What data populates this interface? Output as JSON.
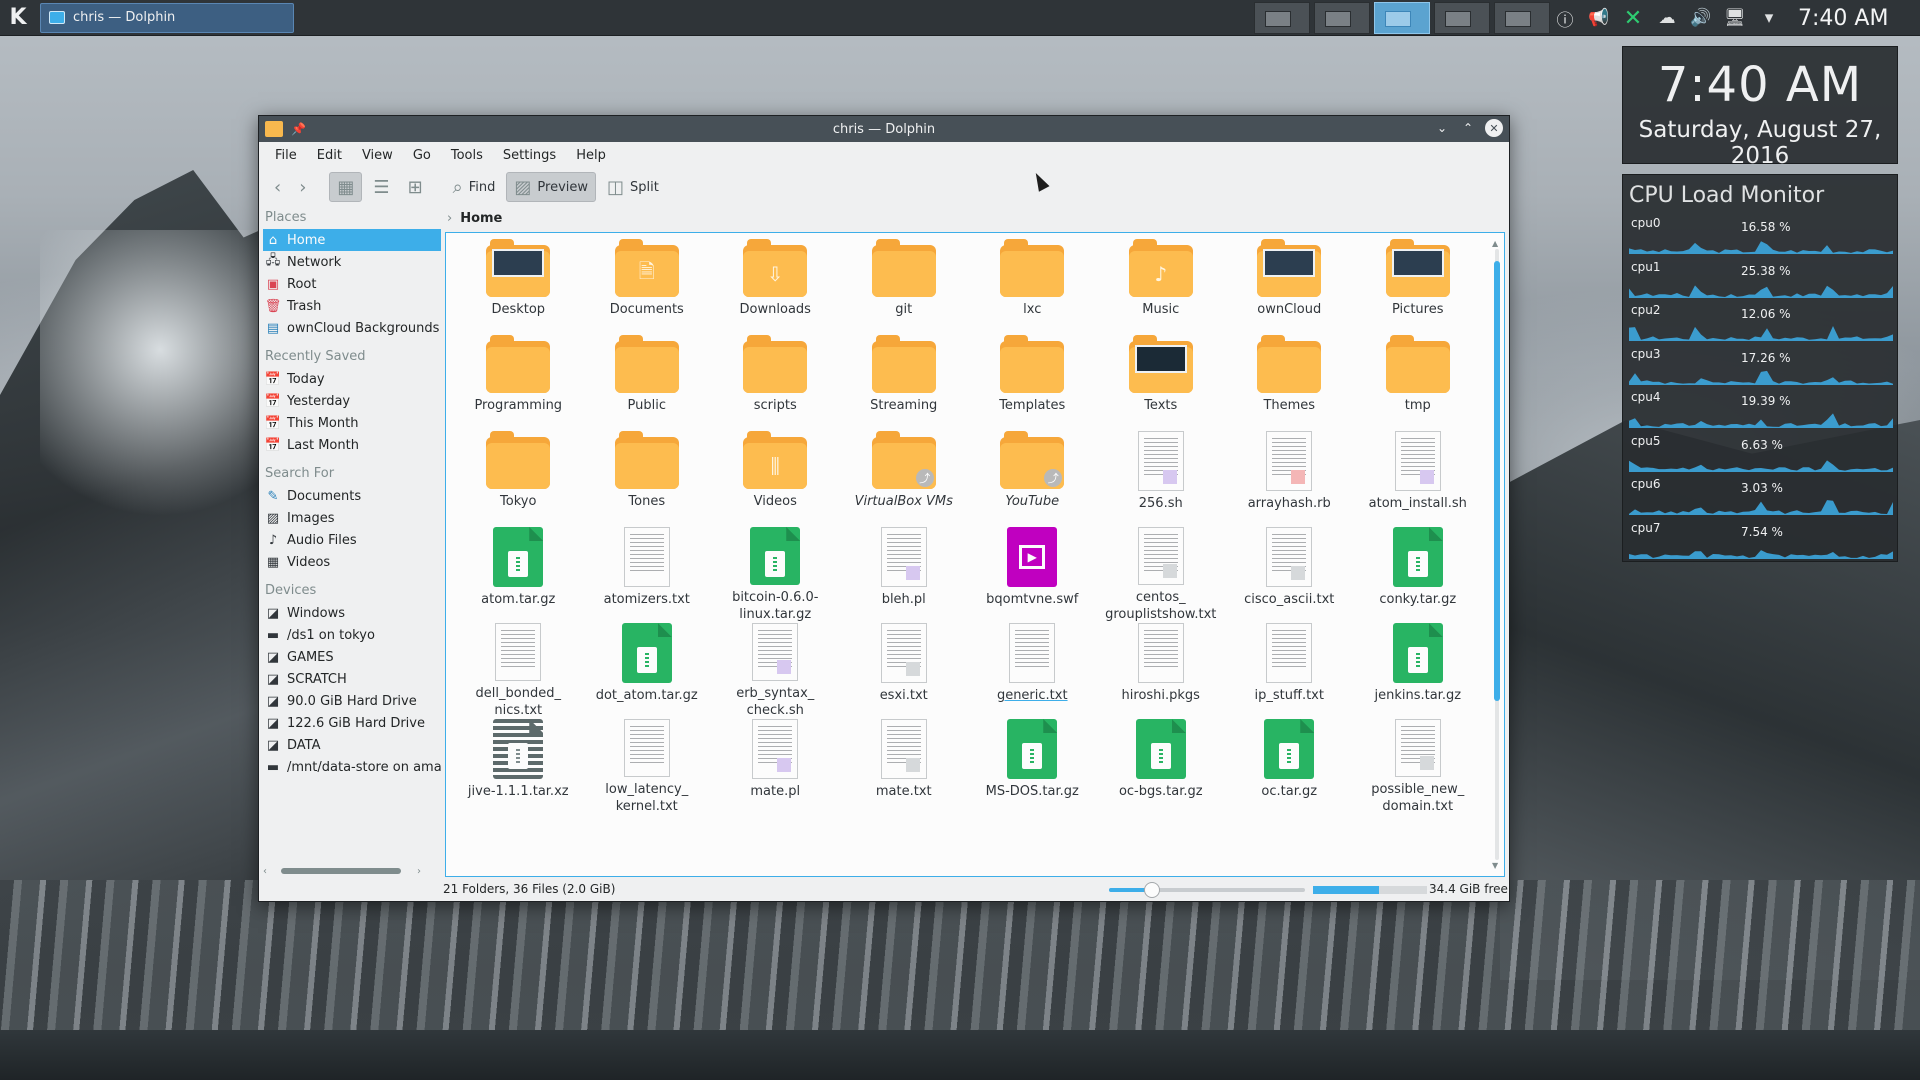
{
  "taskbar": {
    "task_label": "chris — Dolphin",
    "clock": "7:40 AM"
  },
  "clock_widget": {
    "time": "7:40 AM",
    "date": "Saturday, August 27, 2016"
  },
  "cpu_widget": {
    "title": "CPU Load Monitor",
    "cores": [
      {
        "name": "cpu0",
        "value": "16.58 %"
      },
      {
        "name": "cpu1",
        "value": "25.38 %"
      },
      {
        "name": "cpu2",
        "value": "12.06 %"
      },
      {
        "name": "cpu3",
        "value": "17.26 %"
      },
      {
        "name": "cpu4",
        "value": "19.39 %"
      },
      {
        "name": "cpu5",
        "value": "6.63 %"
      },
      {
        "name": "cpu6",
        "value": "3.03 %"
      },
      {
        "name": "cpu7",
        "value": "7.54 %"
      }
    ],
    "graph_color": "#3daee9"
  },
  "window": {
    "title": "chris — Dolphin",
    "menu": [
      "File",
      "Edit",
      "View",
      "Go",
      "Tools",
      "Settings",
      "Help"
    ],
    "toolbar": {
      "find": "Find",
      "preview": "Preview",
      "split": "Split"
    },
    "breadcrumb": "Home",
    "status": "21 Folders, 36 Files (2.0 GiB)",
    "zoom_level": 0.22,
    "disk_used_fraction": 0.58,
    "free_space": "34.4 GiB free"
  },
  "sidebar": {
    "places_header": "Places",
    "places": [
      "Home",
      "Network",
      "Root",
      "Trash",
      "ownCloud Backgrounds"
    ],
    "recent_header": "Recently Saved",
    "recent": [
      "Today",
      "Yesterday",
      "This Month",
      "Last Month"
    ],
    "search_header": "Search For",
    "search": [
      "Documents",
      "Images",
      "Audio Files",
      "Videos"
    ],
    "devices_header": "Devices",
    "devices": [
      "Windows",
      "/ds1 on tokyo",
      "GAMES",
      "SCRATCH",
      "90.0 GiB Hard Drive",
      "122.6 GiB Hard Drive",
      "DATA",
      "/mnt/data-store on amate"
    ]
  },
  "files": [
    {
      "name": "Desktop",
      "type": "folder",
      "icon": "screenshot"
    },
    {
      "name": "Documents",
      "type": "folder",
      "icon": "doc"
    },
    {
      "name": "Downloads",
      "type": "folder",
      "icon": "download"
    },
    {
      "name": "git",
      "type": "folder"
    },
    {
      "name": "lxc",
      "type": "folder"
    },
    {
      "name": "Music",
      "type": "folder",
      "icon": "music"
    },
    {
      "name": "ownCloud",
      "type": "folder",
      "icon": "screenshot"
    },
    {
      "name": "Pictures",
      "type": "folder",
      "icon": "screenshot"
    },
    {
      "name": "Programming",
      "type": "folder"
    },
    {
      "name": "Public",
      "type": "folder"
    },
    {
      "name": "scripts",
      "type": "folder"
    },
    {
      "name": "Streaming",
      "type": "folder"
    },
    {
      "name": "Templates",
      "type": "folder"
    },
    {
      "name": "Texts",
      "type": "folder",
      "icon": "dark"
    },
    {
      "name": "Themes",
      "type": "folder"
    },
    {
      "name": "tmp",
      "type": "folder"
    },
    {
      "name": "Tokyo",
      "type": "folder"
    },
    {
      "name": "Tones",
      "type": "folder"
    },
    {
      "name": "Videos",
      "type": "folder",
      "icon": "film"
    },
    {
      "name": "VirtualBox VMs",
      "type": "folder-link"
    },
    {
      "name": "YouTube",
      "type": "folder-link"
    },
    {
      "name": "256.sh",
      "type": "doc",
      "tag": "purple"
    },
    {
      "name": "arrayhash.rb",
      "type": "doc",
      "tag": "red"
    },
    {
      "name": "atom_install.sh",
      "type": "doc",
      "tag": "purple"
    },
    {
      "name": "atom.tar.gz",
      "type": "archive"
    },
    {
      "name": "atomizers.txt",
      "type": "doc"
    },
    {
      "name": "bitcoin-0.6.0-linux.tar.gz",
      "type": "archive"
    },
    {
      "name": "bleh.pl",
      "type": "doc",
      "tag": "purple"
    },
    {
      "name": "bqomtvne.swf",
      "type": "flash"
    },
    {
      "name": "centos_ grouplistshow.txt",
      "type": "doc",
      "tag": "gray"
    },
    {
      "name": "cisco_ascii.txt",
      "type": "doc",
      "tag": "gray"
    },
    {
      "name": "conky.tar.gz",
      "type": "archive"
    },
    {
      "name": "dell_bonded_ nics.txt",
      "type": "doc"
    },
    {
      "name": "dot_atom.tar.gz",
      "type": "archive"
    },
    {
      "name": "erb_syntax_ check.sh",
      "type": "doc",
      "tag": "purple"
    },
    {
      "name": "esxi.txt",
      "type": "doc",
      "tag": "gray"
    },
    {
      "name": "generic.txt",
      "type": "doc",
      "underlined": true
    },
    {
      "name": "hiroshi.pkgs",
      "type": "doc"
    },
    {
      "name": "ip_stuff.txt",
      "type": "doc"
    },
    {
      "name": "jenkins.tar.gz",
      "type": "archive"
    },
    {
      "name": "jive-1.1.1.tar.xz",
      "type": "archive-gray"
    },
    {
      "name": "low_latency_ kernel.txt",
      "type": "doc"
    },
    {
      "name": "mate.pl",
      "type": "doc",
      "tag": "purple"
    },
    {
      "name": "mate.txt",
      "type": "doc",
      "tag": "gray"
    },
    {
      "name": "MS-DOS.tar.gz",
      "type": "archive"
    },
    {
      "name": "oc-bgs.tar.gz",
      "type": "archive"
    },
    {
      "name": "oc.tar.gz",
      "type": "archive"
    },
    {
      "name": "possible_new_ domain.txt",
      "type": "doc",
      "tag": "gray"
    }
  ]
}
